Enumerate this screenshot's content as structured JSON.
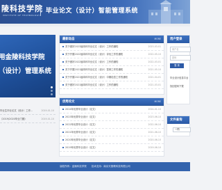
{
  "header": {
    "logo_text": "陵科技学院",
    "logo_sub": "INSTITUTE OF TECHNOLOGY",
    "system_title": "毕业论文（设计）智能管理系统"
  },
  "banner": {
    "line1": "用金陵科技学院",
    "line2": "（设计）管理系统"
  },
  "left_list": [
    {
      "title": "毕业生毕业论文（设计）工作...",
      "date": "2019-01-10"
    },
    {
      "title": "（2019/2020毕业门题）",
      "date": "2019-01-10"
    }
  ],
  "notice_panel": {
    "heading": "最新动态",
    "more": "MORE",
    "items": [
      {
        "title": "关于做好2023届本科毕业论文（设计）工作的通知",
        "date": "2023-03-01"
      },
      {
        "title": "关于开展2022届本科毕业论文（设计）评优工作的通知",
        "date": "2022-05-10"
      },
      {
        "title": "关于做好2022届本科毕业论文（设计）工作的通知",
        "date": "2022-03-01"
      },
      {
        "title": "关于开展2021届本科毕业论文（设计）答辩工作的通知",
        "date": "2021-05-10"
      },
      {
        "title": "关于开展2021届本科毕业论文（设计）中期检查工作的通知",
        "date": "2021-04-01"
      },
      {
        "title": "关于做好2021届本科毕业论文（设计）工作的通知",
        "date": "2021-03-01"
      }
    ]
  },
  "excellent_panel": {
    "heading": "优秀论文",
    "more": "MORE",
    "items": [
      {
        "title": "2024年优秀毕业设计（论文）",
        "date": "2024-01-10"
      },
      {
        "title": "2023年优秀毕业设计（论文）",
        "date": "2023-06-10"
      },
      {
        "title": "2022年优秀毕业设计（论文）",
        "date": "2022-06-10"
      },
      {
        "title": "2021年优秀毕业设计（论文）",
        "date": "2021-06-10"
      },
      {
        "title": "2020年优秀毕业设计（论文）",
        "date": "2020-06-10"
      },
      {
        "title": "2019年优秀毕业设计（论文）",
        "date": "2019-06-10"
      }
    ]
  },
  "login": {
    "heading": "用户登录",
    "username_placeholder": "用户名",
    "password_placeholder": "密码",
    "login_button": "登 录",
    "link1": "毕业设计信息平台",
    "link2": "找回密码下载"
  },
  "query": {
    "heading": "文件查询",
    "select_value": "一同"
  },
  "footer": {
    "text": "版权所有：金陵科技学院　　技术支持：南京天丽教科技有限公司"
  },
  "colors": {
    "primary": "#2d5aa6",
    "header_dark": "#2c4f91",
    "background": "#f2f3f6"
  }
}
